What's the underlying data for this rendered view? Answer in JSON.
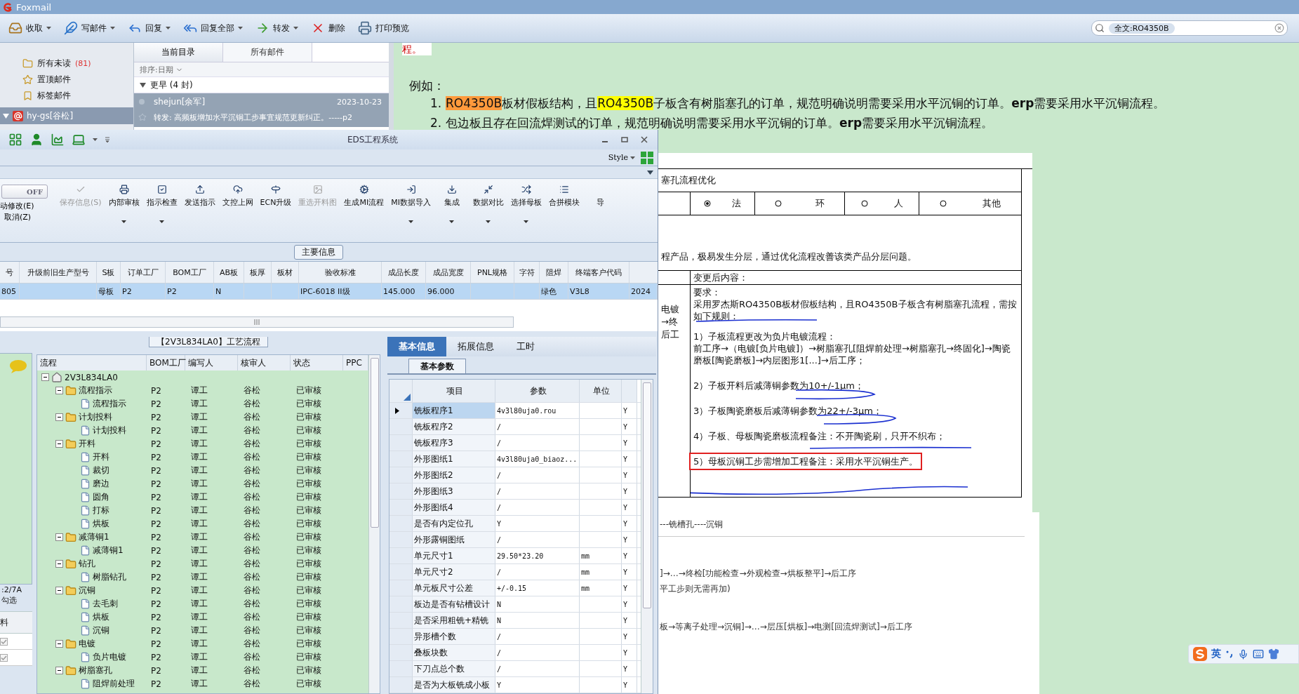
{
  "foxmail": {
    "title": "Foxmail",
    "toolbar": [
      {
        "label": "收取",
        "menu": true
      },
      {
        "label": "写邮件",
        "menu": true
      },
      {
        "label": "回复",
        "menu": true
      },
      {
        "label": "回复全部",
        "menu": true
      },
      {
        "label": "转发",
        "menu": true
      },
      {
        "label": "删除",
        "menu": false
      },
      {
        "label": "打印预览",
        "menu": false
      }
    ],
    "search": {
      "chip": "全文:RO4350B"
    },
    "folders": [
      {
        "label": "所有未读",
        "count": "(81)"
      },
      {
        "label": "置顶邮件"
      },
      {
        "label": "标签邮件"
      }
    ],
    "account": {
      "label": "hy-gs[谷松]",
      "selected": true
    },
    "mail_tabs": [
      {
        "label": "当前目录",
        "selected": true
      },
      {
        "label": "所有邮件",
        "selected": false
      }
    ],
    "sort": "排序:日期",
    "group": "更早 (4 封)",
    "messages": [
      {
        "sender": "shejun[余军]",
        "date": "2023-10-23",
        "subject": "转发: 高频板增加水平沉铜工步事宜规范更新纠正。-----p2",
        "selected": true
      }
    ],
    "reading": {
      "top_fragment": "程。",
      "example_label": "例如：",
      "example_items": [
        {
          "number": "1.",
          "parts": [
            {
              "text": "RO4350B",
              "kind": "current"
            },
            {
              "text": "板材假板结构，且"
            },
            {
              "text": "RO4350B",
              "kind": "match"
            },
            {
              "text": "子板含有树脂塞孔的订单，规范明确说明需要采用水平沉铜的订单。**erp**需要采用水平沉铜流程。"
            }
          ]
        },
        {
          "number": "2.",
          "parts": [
            {
              "text": "包边板且存在回流焊测试的订单，规范明确说明需要采用水平沉铜的订单。**erp**需要采用水平沉铜流程。"
            }
          ]
        }
      ],
      "document": {
        "title": "塞孔流程优化",
        "options": [
          {
            "label": "法",
            "selected": true
          },
          {
            "label": "环",
            "selected": false
          },
          {
            "label": "人",
            "selected": false
          },
          {
            "label": "其他",
            "selected": false
          }
        ],
        "reason": "程产品，极易发生分层，通过优化流程改善该类产品分层问题。",
        "after_label": "变更后内容：",
        "side_text": [
          "电镀",
          "→终",
          "后工"
        ],
        "requirement_label": "要求：",
        "requirement_intro": "采用罗杰斯RO4350B板材假板结构，且RO4350B子板含有树脂塞孔流程，需按如下规则：",
        "rules": [
          {
            "title": "1）子板流程更改为负片电镀流程：",
            "detail": "前工序→（电镀[负片电镀]）→树脂塞孔[阻焊前处理→树脂塞孔→终固化]→陶瓷磨板[陶瓷磨板]→内层图形1[...]→后工序；",
            "boxed": false
          },
          {
            "title": "2）子板开料后减薄铜参数为10+/-1μm；",
            "boxed": false
          },
          {
            "title": "3）子板陶瓷磨板后减薄铜参数为22+/-3μm；",
            "boxed": false
          },
          {
            "title": "4）子板、母板陶瓷磨板流程备注：不开陶瓷刷，只开不织布；",
            "boxed": false
          },
          {
            "title": "5）母板沉铜工步需增加工程备注：采用水平沉铜生产。",
            "boxed": true
          }
        ]
      },
      "document_2": {
        "heading": "---铣槽孔----沉铜",
        "lines": [
          "]→…→终检[功能检查→外观检查→烘板整平]→后工序",
          "平工步则无需再加)",
          "板→等离子处理→沉铜]→…→层压[烘板]→电测[回流焊测试]→后工序"
        ]
      }
    }
  },
  "eds": {
    "title": "EDS工程系统",
    "style_label": "Style",
    "toggle": {
      "label": "OFF",
      "on": false
    },
    "edit_actions": [
      "动修改(E)",
      "取消(Z)"
    ],
    "ribbon": [
      {
        "label": "保存信息(S)",
        "disabled": true,
        "menu": false
      },
      {
        "label": "内部审核",
        "disabled": false,
        "menu": true
      },
      {
        "label": "指示检查",
        "disabled": false,
        "menu": true
      },
      {
        "label": "发送指示",
        "disabled": false,
        "menu": false
      },
      {
        "label": "文控上网",
        "disabled": false,
        "menu": false
      },
      {
        "label": "ECN升级",
        "disabled": false,
        "menu": false
      },
      {
        "label": "重选开料图",
        "disabled": true,
        "menu": false
      },
      {
        "label": "生成MI流程",
        "disabled": false,
        "menu": false
      },
      {
        "label": "MI数据导入",
        "disabled": false,
        "menu": true
      },
      {
        "label": "集成",
        "disabled": false,
        "menu": true
      },
      {
        "label": "数据对比",
        "disabled": false,
        "menu": true
      },
      {
        "label": "选择母板",
        "disabled": false,
        "menu": true
      },
      {
        "label": "合拼模块",
        "disabled": false,
        "menu": false
      },
      {
        "label": "导",
        "disabled": false,
        "menu": false
      }
    ],
    "section_label": "主要信息",
    "main_table": {
      "columns": [
        "号",
        "升级前旧生产型号",
        "S板",
        "订单工厂",
        "BOM工厂",
        "AB板",
        "板厚",
        "板材",
        "验收标准",
        "成品长度",
        "成品宽度",
        "PNL规格",
        "字符",
        "阻焊",
        "终端客户代码"
      ],
      "rows": [
        {
          "selected": true,
          "cells": [
            "805",
            "",
            "母板",
            "P2",
            "P2",
            "N",
            "",
            "",
            "IPC-6018 II级",
            "145.000",
            "96.000",
            "",
            "",
            "绿色",
            "V3L8",
            "2024"
          ]
        }
      ]
    },
    "side_panel": {
      "status": ":2/7A",
      "hint": "勾选",
      "column": "料",
      "checks": [
        {
          "checked": true
        },
        {
          "checked": true
        }
      ]
    },
    "flow": {
      "title": "【2V3L834LA0】工艺流程",
      "columns": [
        "流程",
        "BOM工厂",
        "编写人",
        "核审人",
        "状态",
        "PPC"
      ],
      "tree": [
        {
          "label": "2V3L834LA0",
          "kind": "root",
          "expanded": true,
          "children": [
            {
              "label": "流程指示",
              "kind": "group",
              "expanded": true,
              "cells": [
                "P2",
                "谭工",
                "谷松",
                "已审核"
              ],
              "children": [
                {
                  "label": "流程指示",
                  "kind": "step",
                  "cells": [
                    "P2",
                    "谭工",
                    "谷松",
                    "已审核"
                  ]
                }
              ]
            },
            {
              "label": "计划投料",
              "kind": "group",
              "expanded": true,
              "cells": [
                "P2",
                "谭工",
                "谷松",
                "已审核"
              ],
              "children": [
                {
                  "label": "计划投料",
                  "kind": "step",
                  "cells": [
                    "P2",
                    "谭工",
                    "谷松",
                    "已审核"
                  ]
                }
              ]
            },
            {
              "label": "开料",
              "kind": "group",
              "expanded": true,
              "cells": [
                "P2",
                "谭工",
                "谷松",
                "已审核"
              ],
              "children": [
                {
                  "label": "开料",
                  "kind": "step",
                  "cells": [
                    "P2",
                    "谭工",
                    "谷松",
                    "已审核"
                  ]
                },
                {
                  "label": "裁切",
                  "kind": "step",
                  "cells": [
                    "P2",
                    "谭工",
                    "谷松",
                    "已审核"
                  ]
                },
                {
                  "label": "磨边",
                  "kind": "step",
                  "cells": [
                    "P2",
                    "谭工",
                    "谷松",
                    "已审核"
                  ]
                },
                {
                  "label": "圆角",
                  "kind": "step",
                  "cells": [
                    "P2",
                    "谭工",
                    "谷松",
                    "已审核"
                  ]
                },
                {
                  "label": "打标",
                  "kind": "step",
                  "cells": [
                    "P2",
                    "谭工",
                    "谷松",
                    "已审核"
                  ]
                },
                {
                  "label": "烘板",
                  "kind": "step",
                  "cells": [
                    "P2",
                    "谭工",
                    "谷松",
                    "已审核"
                  ]
                }
              ]
            },
            {
              "label": "减薄铜1",
              "kind": "group",
              "expanded": true,
              "cells": [
                "P2",
                "谭工",
                "谷松",
                "已审核"
              ],
              "children": [
                {
                  "label": "减薄铜1",
                  "kind": "step",
                  "cells": [
                    "P2",
                    "谭工",
                    "谷松",
                    "已审核"
                  ]
                }
              ]
            },
            {
              "label": "钻孔",
              "kind": "group",
              "expanded": true,
              "cells": [
                "P2",
                "谭工",
                "谷松",
                "已审核"
              ],
              "children": [
                {
                  "label": "树脂钻孔",
                  "kind": "step",
                  "cells": [
                    "P2",
                    "谭工",
                    "谷松",
                    "已审核"
                  ]
                }
              ]
            },
            {
              "label": "沉铜",
              "kind": "group",
              "expanded": true,
              "cells": [
                "P2",
                "谭工",
                "谷松",
                "已审核"
              ],
              "children": [
                {
                  "label": "去毛刺",
                  "kind": "step",
                  "cells": [
                    "P2",
                    "谭工",
                    "谷松",
                    "已审核"
                  ]
                },
                {
                  "label": "烘板",
                  "kind": "step",
                  "cells": [
                    "P2",
                    "谭工",
                    "谷松",
                    "已审核"
                  ]
                },
                {
                  "label": "沉铜",
                  "kind": "step",
                  "cells": [
                    "P2",
                    "谭工",
                    "谷松",
                    "已审核"
                  ]
                }
              ]
            },
            {
              "label": "电镀",
              "kind": "group",
              "expanded": true,
              "cells": [
                "P2",
                "谭工",
                "谷松",
                "已审核"
              ],
              "children": [
                {
                  "label": "负片电镀",
                  "kind": "step",
                  "cells": [
                    "P2",
                    "谭工",
                    "谷松",
                    "已审核"
                  ]
                }
              ]
            },
            {
              "label": "树脂塞孔",
              "kind": "group",
              "expanded": true,
              "cells": [
                "P2",
                "谭工",
                "谷松",
                "已审核"
              ],
              "children": [
                {
                  "label": "阻焊前处理",
                  "kind": "step",
                  "cells": [
                    "P2",
                    "谭工",
                    "谷松",
                    "已审核"
                  ]
                }
              ]
            }
          ]
        }
      ]
    },
    "params": {
      "tabs": [
        {
          "label": "基本信息",
          "selected": true
        },
        {
          "label": "拓展信息",
          "selected": false
        },
        {
          "label": "工时",
          "selected": false
        }
      ],
      "subtab": "基本参数",
      "columns": [
        "项目",
        "参数",
        "单位"
      ],
      "rows": [
        {
          "item": "铣板程序1",
          "value": "4v3l80uja0.rou",
          "column_4": "Y",
          "selected": true
        },
        {
          "item": "铣板程序2",
          "value": "/",
          "column_4": "Y",
          "selected": false
        },
        {
          "item": "铣板程序3",
          "value": "/",
          "column_4": "Y",
          "selected": false
        },
        {
          "item": "外形图纸1",
          "value": "4v3l80uja0_biaoz...",
          "column_4": "Y",
          "selected": false
        },
        {
          "item": "外形图纸2",
          "value": "/",
          "column_4": "Y",
          "selected": false
        },
        {
          "item": "外形图纸3",
          "value": "/",
          "column_4": "Y",
          "selected": false
        },
        {
          "item": "外形图纸4",
          "value": "/",
          "column_4": "Y",
          "selected": false
        },
        {
          "item": "是否有内定位孔",
          "value": "Y",
          "column_4": "Y",
          "selected": false
        },
        {
          "item": "外形露铜图纸",
          "value": "/",
          "column_4": "Y",
          "selected": false
        },
        {
          "item": "单元尺寸1",
          "value": "29.50*23.20",
          "unit": "mm",
          "column_4": "Y",
          "selected": false
        },
        {
          "item": "单元尺寸2",
          "value": "/",
          "unit": "mm",
          "column_4": "Y",
          "selected": false
        },
        {
          "item": "单元板尺寸公差",
          "value": "+/-0.15",
          "unit": "mm",
          "column_4": "Y",
          "selected": false
        },
        {
          "item": "板边是否有钻槽设计",
          "value": "N",
          "column_4": "Y",
          "selected": false
        },
        {
          "item": "是否采用粗铣+精铣",
          "value": "N",
          "column_4": "Y",
          "selected": false
        },
        {
          "item": "异形槽个数",
          "value": "/",
          "column_4": "Y",
          "selected": false
        },
        {
          "item": "叠板块数",
          "value": "/",
          "column_4": "Y",
          "selected": false
        },
        {
          "item": "下刀点总个数",
          "value": "/",
          "column_4": "Y",
          "selected": false
        },
        {
          "item": "是否为大板铣成小板",
          "value": "Y",
          "column_4": "Y",
          "selected": false
        }
      ]
    }
  },
  "ime": {
    "label": "英"
  }
}
